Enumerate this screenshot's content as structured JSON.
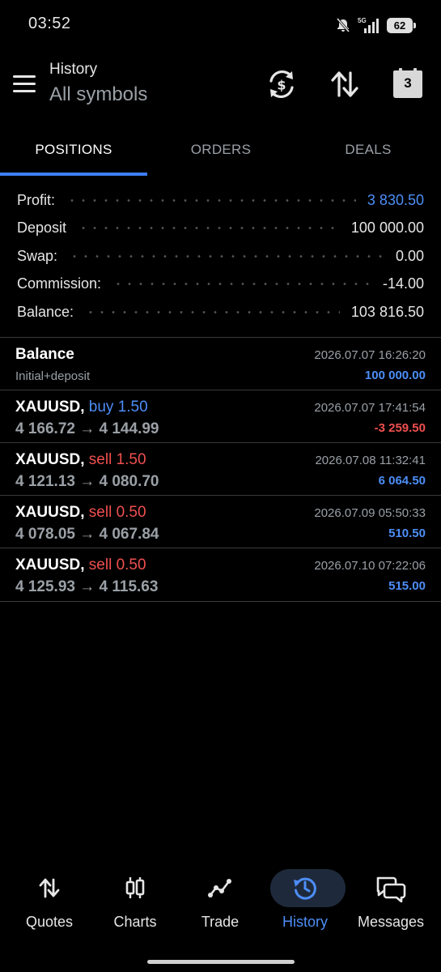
{
  "status_bar": {
    "time": "03:52",
    "network": "5G",
    "battery": "62"
  },
  "header": {
    "title": "History",
    "subtitle": "All symbols",
    "calendar_day": "3"
  },
  "tabs": [
    {
      "label": "POSITIONS"
    },
    {
      "label": "ORDERS"
    },
    {
      "label": "DEALS"
    }
  ],
  "summary": [
    {
      "label": "Profit:",
      "value": "3 830.50"
    },
    {
      "label": "Deposit",
      "value": "100 000.00"
    },
    {
      "label": "Swap:",
      "value": "0.00"
    },
    {
      "label": "Commission:",
      "value": "-14.00"
    },
    {
      "label": "Balance:",
      "value": "103 816.50"
    }
  ],
  "balance_row": {
    "title": "Balance",
    "sub": "Initial+deposit",
    "date": "2026.07.07 16:26:20",
    "amount": "100 000.00"
  },
  "positions": [
    {
      "symbol": "XAUUSD,",
      "side": "buy 1.50",
      "prices": "4 166.72 → 4 144.99",
      "date": "2026.07.07 17:41:54",
      "profit": "-3 259.50"
    },
    {
      "symbol": "XAUUSD,",
      "side": "sell 1.50",
      "prices": "4 121.13 → 4 080.70",
      "date": "2026.07.08 11:32:41",
      "profit": "6 064.50"
    },
    {
      "symbol": "XAUUSD,",
      "side": "sell 0.50",
      "prices": "4 078.05 → 4 067.84",
      "date": "2026.07.09 05:50:33",
      "profit": "510.50"
    },
    {
      "symbol": "XAUUSD,",
      "side": "sell 0.50",
      "prices": "4 125.93 → 4 115.63",
      "date": "2026.07.10 07:22:06",
      "profit": "515.00"
    }
  ],
  "nav": [
    {
      "label": "Quotes",
      "icon": "quotes-icon"
    },
    {
      "label": "Charts",
      "icon": "charts-icon"
    },
    {
      "label": "Trade",
      "icon": "trade-icon"
    },
    {
      "label": "History",
      "icon": "history-icon"
    },
    {
      "label": "Messages",
      "icon": "messages-icon"
    }
  ],
  "colors": {
    "accent": "#3d7ef5",
    "profit": "#4d8ef7",
    "loss": "#f04f4f",
    "muted": "#9aa0a6"
  }
}
